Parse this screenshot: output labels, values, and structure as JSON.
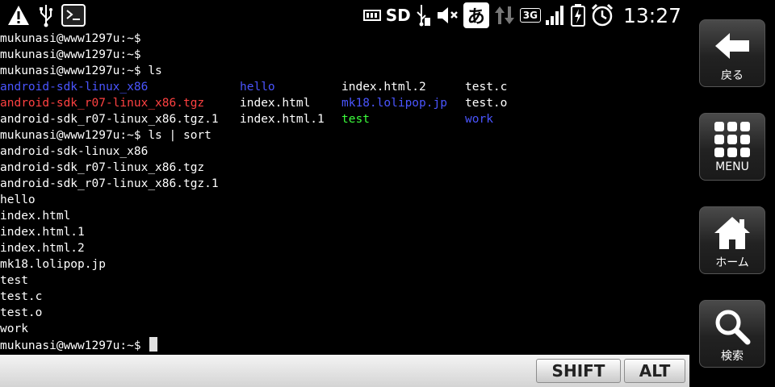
{
  "status_bar": {
    "storage_label": "SD",
    "ime_label": "あ",
    "network_label": "3G",
    "time": "13:27"
  },
  "terminal": {
    "lines": [
      {
        "cells": [
          {
            "text": "mukunasi@www1297u:~$",
            "color": "white"
          }
        ]
      },
      {
        "cells": [
          {
            "text": "mukunasi@www1297u:~$",
            "color": "white"
          }
        ]
      },
      {
        "cells": [
          {
            "text": "mukunasi@www1297u:~$ ls",
            "color": "white"
          }
        ]
      },
      {
        "cells": [
          {
            "text": "android-sdk-linux_x86",
            "color": "blue",
            "col": 0
          },
          {
            "text": "hello",
            "color": "blue",
            "col": 1
          },
          {
            "text": "index.html.2",
            "color": "white",
            "col": 2
          },
          {
            "text": "test.c",
            "color": "white",
            "col": 3
          }
        ]
      },
      {
        "cells": [
          {
            "text": "android-sdk_r07-linux_x86.tgz",
            "color": "red",
            "col": 0
          },
          {
            "text": "index.html",
            "color": "white",
            "col": 1
          },
          {
            "text": "mk18.lolipop.jp",
            "color": "blue",
            "col": 2
          },
          {
            "text": "test.o",
            "color": "white",
            "col": 3
          }
        ]
      },
      {
        "cells": [
          {
            "text": "android-sdk_r07-linux_x86.tgz.1",
            "color": "white",
            "col": 0
          },
          {
            "text": "index.html.1",
            "color": "white",
            "col": 1
          },
          {
            "text": "test",
            "color": "green",
            "col": 2
          },
          {
            "text": "work",
            "color": "blue",
            "col": 3
          }
        ]
      },
      {
        "cells": [
          {
            "text": "mukunasi@www1297u:~$ ls | sort",
            "color": "white"
          }
        ]
      },
      {
        "cells": [
          {
            "text": "android-sdk-linux_x86",
            "color": "white"
          }
        ]
      },
      {
        "cells": [
          {
            "text": "android-sdk_r07-linux_x86.tgz",
            "color": "white"
          }
        ]
      },
      {
        "cells": [
          {
            "text": "android-sdk_r07-linux_x86.tgz.1",
            "color": "white"
          }
        ]
      },
      {
        "cells": [
          {
            "text": "hello",
            "color": "white"
          }
        ]
      },
      {
        "cells": [
          {
            "text": "index.html",
            "color": "white"
          }
        ]
      },
      {
        "cells": [
          {
            "text": "index.html.1",
            "color": "white"
          }
        ]
      },
      {
        "cells": [
          {
            "text": "index.html.2",
            "color": "white"
          }
        ]
      },
      {
        "cells": [
          {
            "text": "mk18.lolipop.jp",
            "color": "white"
          }
        ]
      },
      {
        "cells": [
          {
            "text": "test",
            "color": "white"
          }
        ]
      },
      {
        "cells": [
          {
            "text": "test.c",
            "color": "white"
          }
        ]
      },
      {
        "cells": [
          {
            "text": "test.o",
            "color": "white"
          }
        ]
      },
      {
        "cells": [
          {
            "text": "work",
            "color": "white"
          }
        ]
      },
      {
        "cells": [
          {
            "text": "mukunasi@www1297u:~$ ",
            "color": "white"
          }
        ],
        "cursor": true
      }
    ]
  },
  "key_bar": {
    "shift_label": "SHIFT",
    "alt_label": "ALT"
  },
  "nav": {
    "back_label": "戻る",
    "menu_label": "MENU",
    "home_label": "ホーム",
    "search_label": "検索"
  }
}
